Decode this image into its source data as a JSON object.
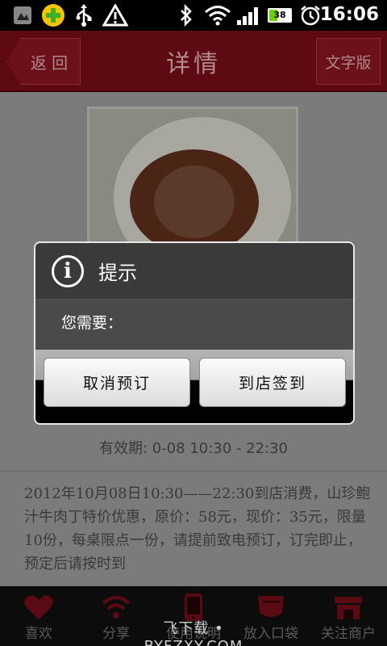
{
  "status_bar": {
    "time": "16:06",
    "battery": "38",
    "battery_level": 0.38,
    "icons": [
      "gallery-icon",
      "360-security-icon",
      "usb-icon",
      "warning-icon",
      "bluetooth-icon",
      "wifi-icon",
      "signal-icon",
      "battery-icon",
      "alarm-icon"
    ]
  },
  "header": {
    "back_label": "返 回",
    "title": "详情",
    "text_version_label": "文字版"
  },
  "content": {
    "valid_period": "有效期: 0-08 10:30 - 22:30",
    "description": "2012年10月08日10:30——22:30到店消费，山珍鲍汁牛肉丁特价优惠，原价：58元，现价：35元，限量10份，每桌限点一份，请提前致电预订，订完即止，预定后请按时到"
  },
  "dialog": {
    "title": "提示",
    "message": "您需要：",
    "cancel_label": "取消预订",
    "checkin_label": "到店签到"
  },
  "bottom_nav": {
    "items": [
      {
        "label": "喜欢",
        "icon": "heart-icon"
      },
      {
        "label": "分享",
        "icon": "share-icon"
      },
      {
        "label": "使用说明",
        "icon": "phone-icon"
      },
      {
        "label": "放入口袋",
        "icon": "pocket-icon"
      },
      {
        "label": "关注商户",
        "icon": "store-icon"
      }
    ]
  },
  "watermark": "飞下载 • BYFZXY.COM",
  "colors": {
    "header_bg": "#5e0a12",
    "dialog_bg": "#3a3a3a",
    "nav_bg": "#0c0c0c"
  }
}
